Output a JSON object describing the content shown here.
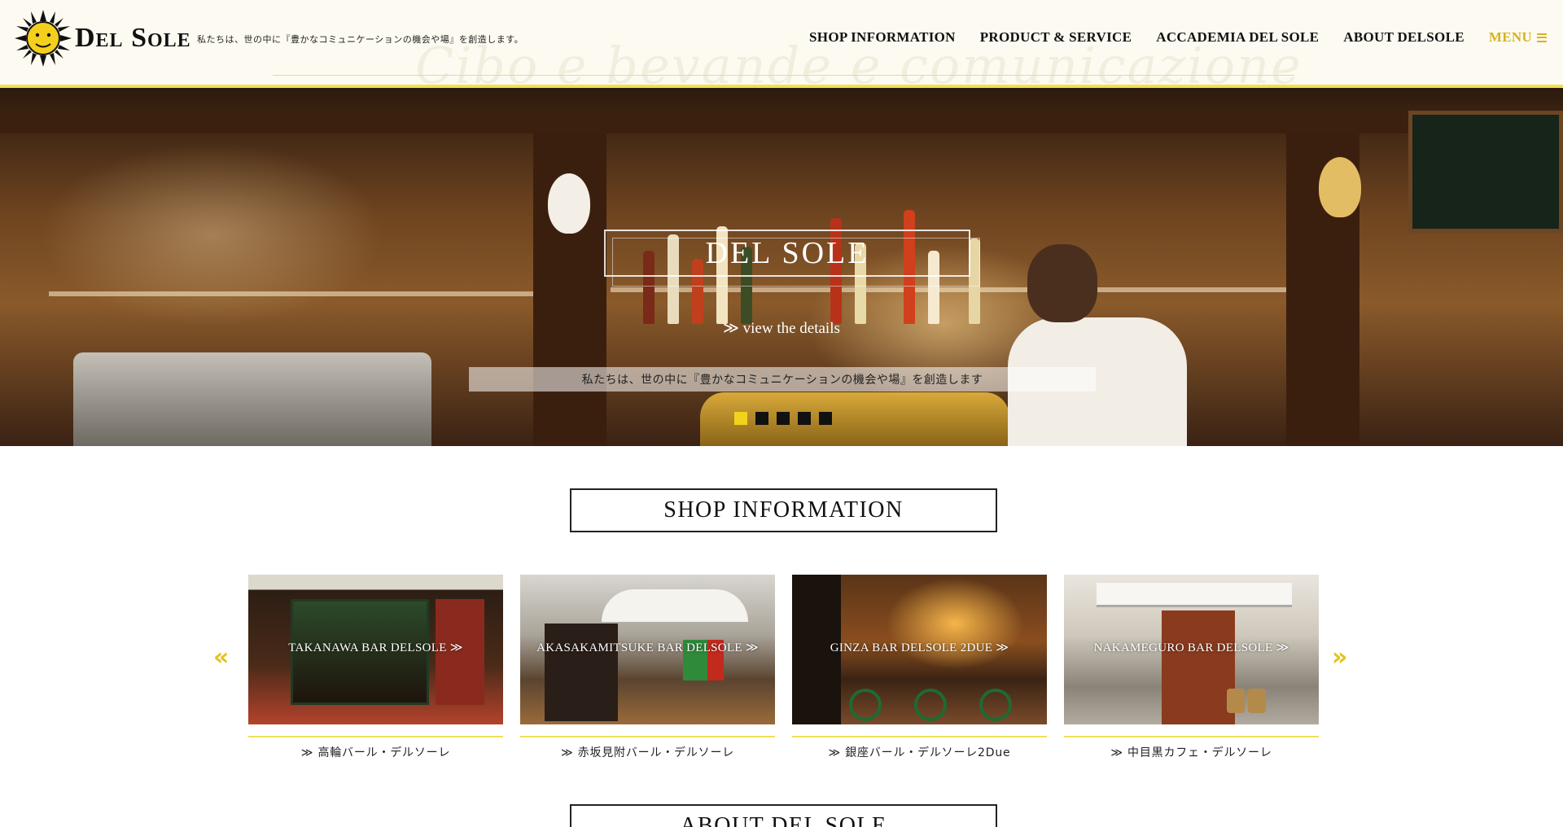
{
  "header": {
    "logo_text": "Del Sole",
    "tagline": "私たちは、世の中に『豊かなコミュニケーションの機会や場』を創造します。",
    "watermark": "Cibo e bevande e comunicazione",
    "nav": [
      {
        "label": "SHOP INFORMATION"
      },
      {
        "label": "PRODUCT & SERVICE"
      },
      {
        "label": "ACCADEMIA DEL SOLE"
      },
      {
        "label": "ABOUT DELSOLE"
      }
    ],
    "menu_label": "MENU"
  },
  "hero": {
    "title": "DEL SOLE",
    "link": "≫ view the details",
    "caption": "私たちは、世の中に『豊かなコミュニケーションの機会や場』を創造します",
    "slide_count": 5,
    "active_slide": 1
  },
  "shop_section": {
    "heading": "SHOP INFORMATION",
    "prev": "«",
    "next": "»",
    "shops": [
      {
        "overlay": "TAKANAWA BAR DELSOLE ≫",
        "name": "≫ 高輪バール・デルソーレ"
      },
      {
        "overlay": "AKASAKAMITSUKE BAR DELSOLE ≫",
        "name": "≫ 赤坂見附バール・デルソーレ"
      },
      {
        "overlay": "GINZA BAR DELSOLE 2DUE ≫",
        "name": "≫ 銀座バール・デルソーレ2Due"
      },
      {
        "overlay": "NAKAMEGURO BAR DELSOLE ≫",
        "name": "≫ 中目黒カフェ・デルソーレ"
      }
    ]
  },
  "about_section": {
    "heading": "ABOUT DEL SOLE"
  },
  "colors": {
    "accent": "#f2e04a",
    "menu": "#d7b320",
    "header_bg": "#fdfbf1"
  }
}
